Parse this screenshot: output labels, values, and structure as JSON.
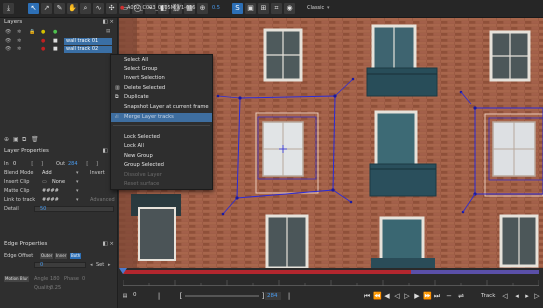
{
  "toolbar": {
    "clip_name": "A002_C003_0105M_V1-016",
    "preset": "Classic",
    "zoom_field": "0.5"
  },
  "left_panel": {
    "layers_title": "Layers",
    "layers": [
      {
        "name": "wall track 01"
      },
      {
        "name": "wall track 02"
      }
    ],
    "layer_props_title": "Layer Properties",
    "in_label": "In",
    "in_value": "0",
    "out_label": "Out",
    "out_value": "284",
    "blend_label": "Blend Mode",
    "blend_value": "Add",
    "invert_label": "Invert",
    "insert_clip_label": "Insert Clip",
    "insert_clip_value": "None",
    "matte_clip_label": "Matte Clip",
    "matte_clip_value": "####",
    "link_label": "Link to track",
    "link_value": "####",
    "advanced_label": "Advanced",
    "detail_label": "Detail",
    "detail_value": "50",
    "edge_title": "Edge Properties",
    "edge_offset_label": "Edge Offset",
    "edge_modes": [
      "Outer",
      "Inner",
      "Both"
    ],
    "edge_value": "0",
    "set_label": "Set",
    "motion_blur_label": "Motion Blur",
    "angle_label": "Angle",
    "angle_value": "180",
    "phase_label": "Phase",
    "phase_value": "0",
    "quality_label": "Quality",
    "quality_value": "0.25"
  },
  "context_menu": {
    "items": [
      {
        "label": "Select All",
        "state": "normal"
      },
      {
        "label": "Select Group",
        "state": "normal"
      },
      {
        "label": "Invert Selection",
        "state": "normal"
      },
      {
        "label": "Delete Selected",
        "state": "normal",
        "icon": "trash-icon"
      },
      {
        "label": "Duplicate",
        "state": "normal",
        "icon": "duplicate-icon"
      },
      {
        "label": "Snapshot Layer at current frame",
        "state": "normal"
      },
      {
        "label": "Merge Layer tracks",
        "state": "highlighted",
        "icon": "merge-icon"
      },
      {
        "label": "Lock Selected",
        "state": "normal"
      },
      {
        "label": "Lock All",
        "state": "normal"
      },
      {
        "label": "New Group",
        "state": "normal"
      },
      {
        "label": "Group Selected",
        "state": "normal"
      },
      {
        "label": "Dissolve Layer",
        "state": "disabled"
      },
      {
        "label": "Reset surface",
        "state": "disabled"
      }
    ]
  },
  "timeline": {
    "start_frame": "0",
    "current_frame": "284",
    "track_label": "Track",
    "playhead_progress": 0.0,
    "track_range_end": 0.7
  },
  "colors": {
    "accent": "#2d6fb5",
    "spline": "#2b2bd8",
    "spline_point": "#1a1aa0",
    "track_bar": "#b3262e",
    "track_bar_tail": "#5a4fa8"
  }
}
